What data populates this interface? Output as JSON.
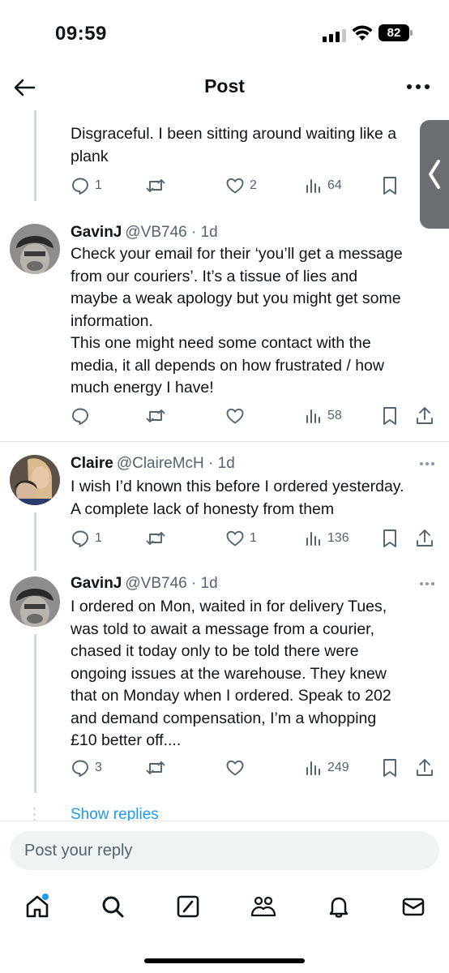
{
  "status": {
    "time": "09:59",
    "battery": "82"
  },
  "header": {
    "title": "Post"
  },
  "tweets": [
    {
      "text": "Disgraceful. I been sitting around waiting like a\nplank",
      "replies": "1",
      "reposts": "",
      "likes": "2",
      "views": "64"
    },
    {
      "name": "GavinJ",
      "handle": "@VB746 · 1d",
      "text": "Check your email for their ‘you’ll get a message\nfrom our couriers’. It’s a tissue of lies and\nmaybe a weak apology but you might get some\ninformation.\nThis one might need some contact with the\nmedia, it all depends on how frustrated / how\nmuch energy I have!",
      "replies": "",
      "reposts": "",
      "likes": "",
      "views": "58"
    },
    {
      "name": "Claire",
      "handle": "@ClaireMcH · 1d",
      "text": "I wish I’d known this before I ordered yesterday.\nA complete lack of honesty from them",
      "replies": "1",
      "reposts": "",
      "likes": "1",
      "views": "136"
    },
    {
      "name": "GavinJ",
      "handle": "@VB746 · 1d",
      "text": "I ordered on Mon, waited in for delivery Tues,\nwas told to await a message from a courier,\nchased it today only to be told there were\nongoing issues at the warehouse. They knew\nthat on Monday when I ordered. Speak to 202\nand demand compensation, I’m a whopping\n£10 better off....",
      "replies": "3",
      "reposts": "",
      "likes": "",
      "views": "249"
    }
  ],
  "show_replies": "Show replies",
  "reply": {
    "placeholder": "Post your reply"
  },
  "tabs": [
    "home-icon",
    "search-icon",
    "grok-icon",
    "communities-icon",
    "notifications-icon",
    "messages-icon"
  ],
  "colors": {
    "accent": "#1d9bf0",
    "icon": "#536471",
    "text": "#0f1419"
  }
}
